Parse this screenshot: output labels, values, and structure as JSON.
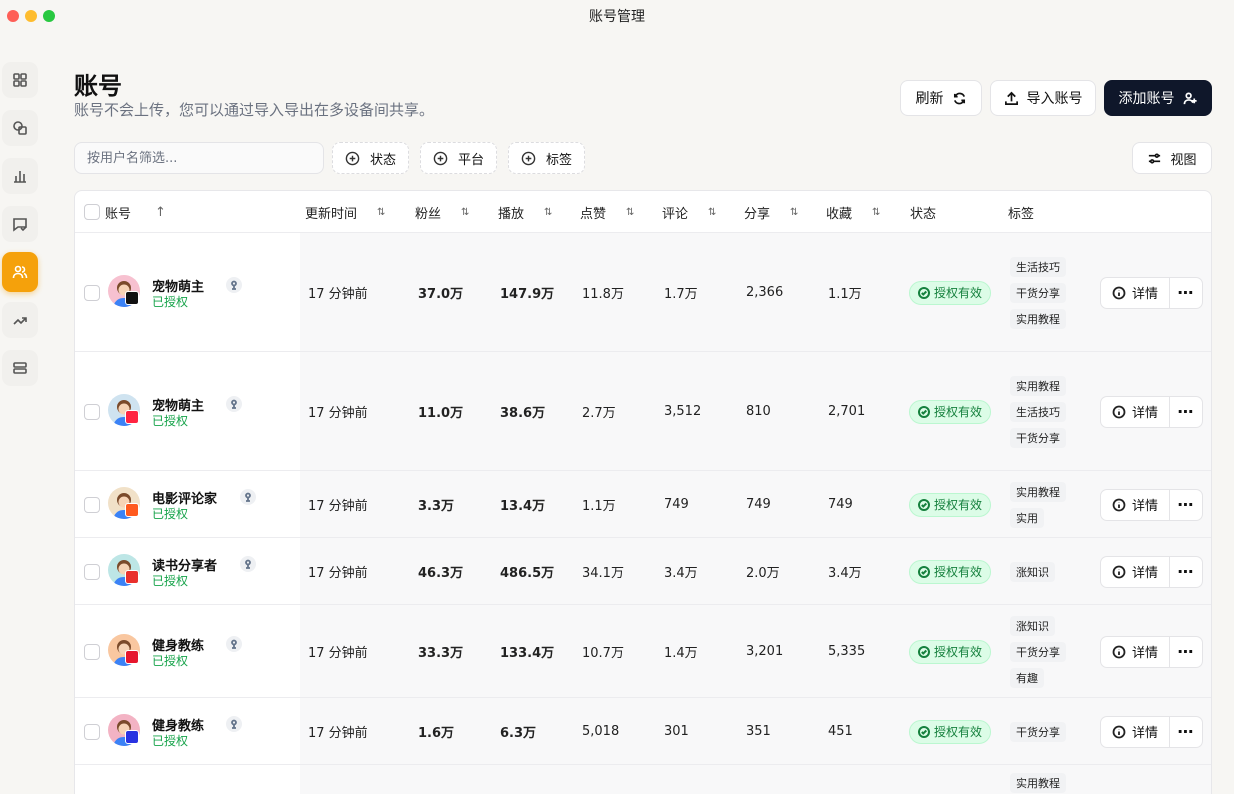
{
  "window": {
    "title": "账号管理"
  },
  "sidebar": {
    "items": [
      {
        "icon": "dashboard-icon"
      },
      {
        "icon": "layers-icon"
      },
      {
        "icon": "bar-chart-icon"
      },
      {
        "icon": "comment-check-icon"
      },
      {
        "icon": "users-icon",
        "active": true
      },
      {
        "icon": "trending-icon"
      },
      {
        "icon": "server-icon"
      }
    ]
  },
  "header": {
    "title": "账号",
    "subtitle": "账号不会上传，您可以通过导入导出在多设备间共享。",
    "refresh_label": "刷新",
    "import_label": "导入账号",
    "add_label": "添加账号"
  },
  "filters": {
    "search_placeholder": "按用户名筛选...",
    "status_label": "状态",
    "platform_label": "平台",
    "tags_label": "标签",
    "view_label": "视图"
  },
  "table": {
    "columns": {
      "account": "账号",
      "updated": "更新时间",
      "fans": "粉丝",
      "plays": "播放",
      "likes": "点赞",
      "comments": "评论",
      "shares": "分享",
      "favorites": "收藏",
      "status": "状态",
      "tags": "标签"
    },
    "detail_label": "详情",
    "more_label": "⋯",
    "rows": [
      {
        "name": "宠物萌主",
        "auth": "已授权",
        "platform": "douyin",
        "updated": "17 分钟前",
        "fans": "37.0万",
        "plays": "147.9万",
        "likes": "11.8万",
        "comments": "1.7万",
        "shares": "2,366",
        "favorites": "1.1万",
        "status": "授权有效",
        "tags": [
          "生活技巧",
          "干货分享",
          "实用教程"
        ]
      },
      {
        "name": "宠物萌主",
        "auth": "已授权",
        "platform": "xiaohongshu",
        "updated": "17 分钟前",
        "fans": "11.0万",
        "plays": "38.6万",
        "likes": "2.7万",
        "comments": "3,512",
        "shares": "810",
        "favorites": "2,701",
        "status": "授权有效",
        "tags": [
          "实用教程",
          "生活技巧",
          "干货分享"
        ]
      },
      {
        "name": "电影评论家",
        "auth": "已授权",
        "platform": "kuaishou",
        "updated": "17 分钟前",
        "fans": "3.3万",
        "plays": "13.4万",
        "likes": "1.1万",
        "comments": "749",
        "shares": "749",
        "favorites": "749",
        "status": "授权有效",
        "tags": [
          "实用教程",
          "实用"
        ]
      },
      {
        "name": "读书分享者",
        "auth": "已授权",
        "platform": "toutiao",
        "updated": "17 分钟前",
        "fans": "46.3万",
        "plays": "486.5万",
        "likes": "34.1万",
        "comments": "3.4万",
        "shares": "2.0万",
        "favorites": "3.4万",
        "status": "授权有效",
        "tags": [
          "涨知识"
        ]
      },
      {
        "name": "健身教练",
        "auth": "已授权",
        "platform": "weibo",
        "updated": "17 分钟前",
        "fans": "33.3万",
        "plays": "133.4万",
        "likes": "10.7万",
        "comments": "1.4万",
        "shares": "3,201",
        "favorites": "5,335",
        "status": "授权有效",
        "tags": [
          "涨知识",
          "干货分享",
          "有趣"
        ]
      },
      {
        "name": "健身教练",
        "auth": "已授权",
        "platform": "baidu",
        "updated": "17 分钟前",
        "fans": "1.6万",
        "plays": "6.3万",
        "likes": "5,018",
        "comments": "301",
        "shares": "351",
        "favorites": "451",
        "status": "授权有效",
        "tags": [
          "干货分享"
        ]
      },
      {
        "name": "",
        "auth": "",
        "platform": "",
        "updated": "",
        "fans": "",
        "plays": "",
        "likes": "",
        "comments": "",
        "shares": "",
        "favorites": "",
        "status": "",
        "tags": [
          "实用教程"
        ]
      }
    ]
  }
}
